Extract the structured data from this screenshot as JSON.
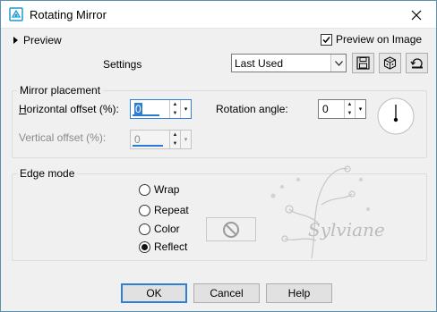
{
  "window": {
    "title": "Rotating Mirror"
  },
  "preview_section": {
    "label": "Preview"
  },
  "preview_on_image": {
    "label": "Preview on Image",
    "checked": true
  },
  "settings": {
    "label": "Settings",
    "value": "Last Used"
  },
  "mirror_placement": {
    "title": "Mirror placement",
    "horizontal_offset": {
      "label": "Horizontal offset (%):",
      "value": "0"
    },
    "vertical_offset": {
      "label": "Vertical offset (%):",
      "value": "0"
    },
    "rotation_angle": {
      "label": "Rotation angle:",
      "value": "0"
    }
  },
  "edge_mode": {
    "title": "Edge mode",
    "options": [
      "Wrap",
      "Repeat",
      "Color",
      "Reflect"
    ],
    "selected": "Reflect"
  },
  "watermark": {
    "text": "Sylviane"
  },
  "buttons": {
    "ok": "OK",
    "cancel": "Cancel",
    "help": "Help"
  },
  "colors": {
    "accent": "#2f7fd6",
    "title_icon": "#1f9bd1"
  }
}
